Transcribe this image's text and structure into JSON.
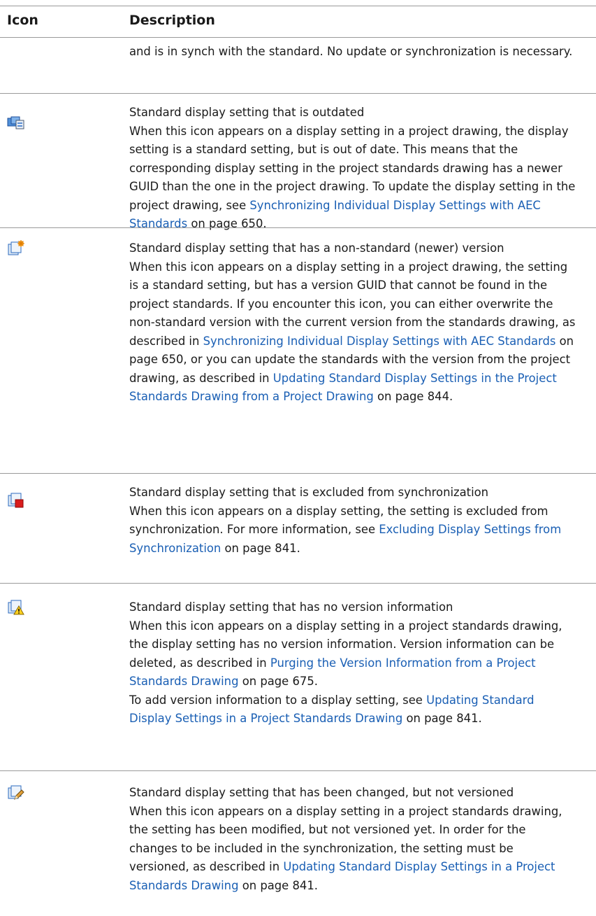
{
  "table": {
    "headers": {
      "icon": "Icon",
      "description": "Description"
    },
    "rows": [
      {
        "continued_text": "and is in synch with the standard. No update or synchronization is necessary."
      },
      {
        "icon": "outdated-setting-icon",
        "title": "Standard display setting that is outdated",
        "body": "When this icon appears on a display setting in a project drawing, the display setting is a standard setting, but is out of date. This means that the corresponding display setting in the project standards drawing has a newer GUID than the one in the project drawing. To update the display setting in the project drawing, see ",
        "link": "Synchronizing Individual Display Settings with AEC Standards",
        "page_ref": " on page 650."
      },
      {
        "icon": "newer-version-setting-icon",
        "title": "Standard display setting that has a non-standard (newer) version",
        "body": "When this icon appears on a display setting in a project drawing, the setting is a standard setting, but has a version GUID that cannot be found in the project standards. If you encounter this icon, you can either overwrite the non-standard version with the current version from the standards drawing, as described in ",
        "link": "Synchronizing Individual Display Settings with AEC Standards",
        "mid": " on page 650, or you can update the standards with the version from the project drawing, as described in ",
        "link2": "Updating Standard Display Settings in the Project Standards Drawing from a Project Drawing",
        "page_ref": " on page 844."
      },
      {
        "icon": "excluded-setting-icon",
        "title": "Standard display setting that is excluded from synchronization",
        "body": "When this icon appears on a display setting, the setting is excluded from synchronization. For more information, see ",
        "link": "Excluding Display Settings from Synchronization",
        "page_ref": " on page 841."
      },
      {
        "icon": "no-version-warning-icon",
        "title": "Standard display setting that has no version information",
        "body": "When this icon appears on a display setting in a project standards drawing, the display setting has no version information. Version information can be deleted, as described in ",
        "link": "Purging the Version Information from a Project Standards Drawing",
        "page_ref": " on page 675.",
        "body2": "To add version information to a display setting, see ",
        "link2": "Updating Standard Display Settings in a Project Standards Drawing",
        "page_ref2": " on page 841."
      },
      {
        "icon": "changed-not-versioned-icon",
        "title": "Standard display setting that has been changed, but not versioned",
        "body": "When this icon appears on a display setting in a project standards drawing, the setting has been modified, but not versioned yet. In order for the changes to be included in the synchronization, the setting must be versioned, as described in ",
        "link": "Updating Standard Display Settings in a Project Standards Drawing",
        "page_ref": " on page 841."
      }
    ]
  }
}
